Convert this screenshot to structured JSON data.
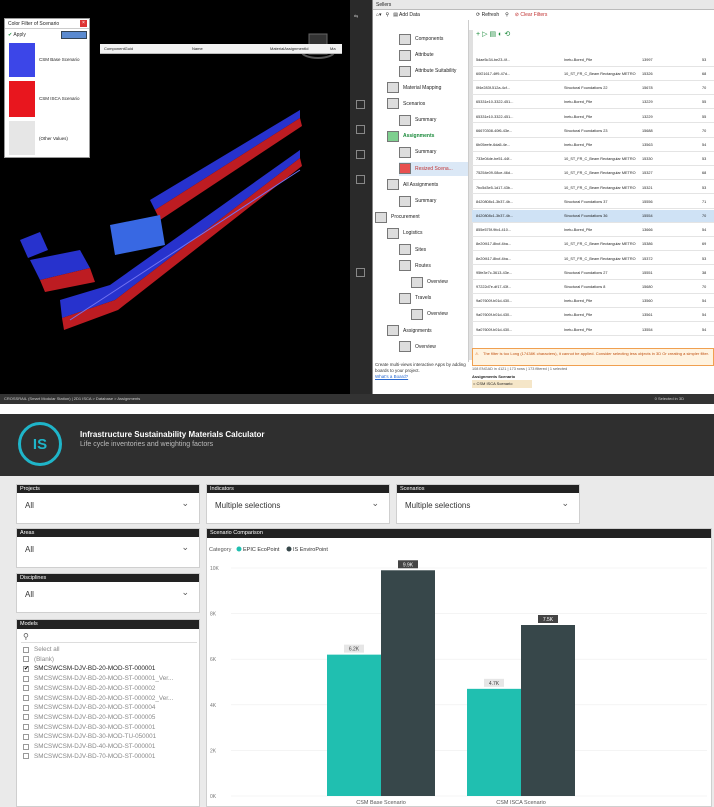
{
  "viewer": {
    "legend_title": "Color Filter of Scenario",
    "apply_label": "Apply",
    "legend_items": [
      {
        "label": "CSM Base Scenario",
        "color": "#3c46e8"
      },
      {
        "label": "CSM ISCA Scenario",
        "color": "#e8161e"
      },
      {
        "label": "(Other Values)",
        "color": "#e6e6e6"
      }
    ]
  },
  "database": {
    "title": "Sellers",
    "toolbar_add": "Add Data",
    "toolbar_refresh": "Refresh",
    "toolbar_clear": "Clear Filters",
    "tree": [
      {
        "label": "Components",
        "indent": 2
      },
      {
        "label": "Attribute",
        "indent": 2
      },
      {
        "label": "Attribute Suitability",
        "indent": 2
      },
      {
        "label": "Material Mapping",
        "indent": 1
      },
      {
        "label": "Scenarios",
        "indent": 1
      },
      {
        "label": "Summary",
        "indent": 2
      },
      {
        "label": "Assignments",
        "indent": 1,
        "green": true
      },
      {
        "label": "Summary",
        "indent": 2
      },
      {
        "label": "Resized Scena...",
        "indent": 2,
        "selected": true,
        "red": true
      },
      {
        "label": "All Assignments",
        "indent": 1
      },
      {
        "label": "Summary",
        "indent": 2
      },
      {
        "label": "Procurement",
        "indent": 0
      },
      {
        "label": "Logistics",
        "indent": 1
      },
      {
        "label": "Sites",
        "indent": 2
      },
      {
        "label": "Routes",
        "indent": 2
      },
      {
        "label": "Overview",
        "indent": 3
      },
      {
        "label": "Travels",
        "indent": 2
      },
      {
        "label": "Overview",
        "indent": 3
      },
      {
        "label": "Assignments",
        "indent": 1
      },
      {
        "label": "Overview",
        "indent": 2
      }
    ],
    "tree_footer": "Create multi-views interactive Apps by adding boards to your project.",
    "tree_footer_link": "What's a Board?",
    "columns": [
      "ComponentGuid",
      "Name",
      "MaterialAssignmentId",
      "Ma"
    ],
    "rows": [
      [
        "5dae5c34-be23-4f...",
        "Inetu-Bored_Pile",
        "13997",
        "53"
      ],
      [
        "60f21617-4ff9-47d...",
        "10_ST_FR_C_Beam Rectangular METRO",
        "15326",
        "68"
      ],
      [
        "0f4e283f-512a-4cf...",
        "Structural Foundations 22",
        "15678",
        "70"
      ],
      [
        "65331e10-3322-451...",
        "Inetu-Bored_Pile",
        "13229",
        "55"
      ],
      [
        "65331e10-3322-451...",
        "Inetu-Bored_Pile",
        "13229",
        "55"
      ],
      [
        "66670308-40f6-43e...",
        "Structural Foundations 23",
        "15688",
        "70"
      ],
      [
        "6b05eefe-6da5-4e...",
        "Inetu-Bored_Pile",
        "13563",
        "54"
      ],
      [
        "733e04de-be51-44f...",
        "10_ST_FR_C_Beam Rectangular METRO",
        "15330",
        "53"
      ],
      [
        "75254e09-08ce-46d...",
        "10_ST_FR_C_Beam Rectangular METRO",
        "15327",
        "68"
      ],
      [
        "7bc5d3e5-1d17-43b...",
        "10_ST_FR_C_Beam Rectangular METRO",
        "15321",
        "53"
      ],
      [
        "8420808c1-3b37-4b...",
        "Structural Foundations 37",
        "15556",
        "71"
      ],
      [
        "8420808c1-3b37-4b...",
        "Structural Foundations 36",
        "15554",
        "70"
      ],
      [
        "855e575f-9fc4-410...",
        "Inetu-Bored_Pile",
        "13666",
        "54"
      ],
      [
        "8e20f417-8bcf-4ba...",
        "10_ST_FR_C_Beam Rectangular METRO",
        "15386",
        "69"
      ],
      [
        "8e20f417-8bcf-4ba...",
        "10_ST_FR_C_Beam Rectangular METRO",
        "15372",
        "53"
      ],
      [
        "95fe3e7c-3613-43e...",
        "Structural Foundations 27",
        "15551",
        "38"
      ],
      [
        "97222d7e-df17-43f...",
        "Structural Foundations 8",
        "15680",
        "70"
      ],
      [
        "9a07600f-b01d-430...",
        "Inetu-Bored_Pile",
        "13560",
        "54"
      ],
      [
        "9a07600f-b01d-430...",
        "Inetu-Bored_Pile",
        "13561",
        "54"
      ],
      [
        "9a07600f-b01d-430...",
        "Inetu-Bored_Pile",
        "13554",
        "54"
      ]
    ],
    "warning": "The filter is too Long (17438K characters), it cannot be applied. Consider selecting less objects in 3D Or creating a simpler filter.",
    "status_count": "108 ENGAD in 4121 | 173 rows | 173 filtered | 1 selected",
    "assign_label": "Assignments Scenario",
    "assign_value": "= CSM ISCA Scenario",
    "bottom_status": "CROSSRAIL (Smart Modular Station) | 2D1 ISCA > Database > Assignments",
    "bottom_right": "0 Selected in 3D"
  },
  "report": {
    "title": "Infrastructure Sustainability Materials Calculator",
    "subtitle": "Life cycle inventories and weighting factors",
    "logo": "IS",
    "slicers": {
      "projects": {
        "header": "Projects",
        "value": "All"
      },
      "indicators": {
        "header": "Indicators",
        "value": "Multiple selections"
      },
      "scenarios": {
        "header": "Scenarios",
        "value": "Multiple selections"
      },
      "areas": {
        "header": "Areas",
        "value": "All"
      },
      "disciplines": {
        "header": "Disciplines",
        "value": "All"
      }
    },
    "models": {
      "header": "Models",
      "search_icon": "search-icon",
      "items": [
        {
          "label": "Select all",
          "checked": false
        },
        {
          "label": "(Blank)",
          "checked": false
        },
        {
          "label": "SMCSWCSM-DJV-BD-20-MOD-ST-000001",
          "checked": true
        },
        {
          "label": "SMCSWCSM-DJV-BD-20-MOD-ST-000001_Ver...",
          "checked": false
        },
        {
          "label": "SMCSWCSM-DJV-BD-20-MOD-ST-000002",
          "checked": false
        },
        {
          "label": "SMCSWCSM-DJV-BD-20-MOD-ST-000002_Ver...",
          "checked": false
        },
        {
          "label": "SMCSWCSM-DJV-BD-20-MOD-ST-000004",
          "checked": false
        },
        {
          "label": "SMCSWCSM-DJV-BD-20-MOD-ST-000005",
          "checked": false
        },
        {
          "label": "SMCSWCSM-DJV-BD-30-MOD-ST-000001",
          "checked": false
        },
        {
          "label": "SMCSWCSM-DJV-BD-30-MOD-TU-050001",
          "checked": false
        },
        {
          "label": "SMCSWCSM-DJV-BD-40-MOD-ST-000001",
          "checked": false
        },
        {
          "label": "SMCSWCSM-DJV-BD-70-MOD-ST-000001",
          "checked": false
        }
      ]
    },
    "chart_header": "Scenario Comparison"
  },
  "chart_data": {
    "type": "bar",
    "legend_title": "Category",
    "categories": [
      "CSM Base Scenario",
      "CSM ISCA Scenario"
    ],
    "series": [
      {
        "name": "EPIC EcoPoint",
        "color": "#20bfb0",
        "values": [
          6200,
          4700
        ],
        "labels": [
          "6.2K",
          "4.7K"
        ]
      },
      {
        "name": "IS EnviroPoint",
        "color": "#37474a",
        "values": [
          9900,
          7500
        ],
        "labels": [
          "9.9K",
          "7.5K"
        ]
      }
    ],
    "ylim": [
      0,
      10000
    ],
    "yticks": [
      0,
      2000,
      4000,
      6000,
      8000,
      10000
    ],
    "ytick_labels": [
      "0K",
      "2K",
      "4K",
      "6K",
      "8K",
      "10K"
    ],
    "grid": true,
    "legend_position": "top-left"
  }
}
